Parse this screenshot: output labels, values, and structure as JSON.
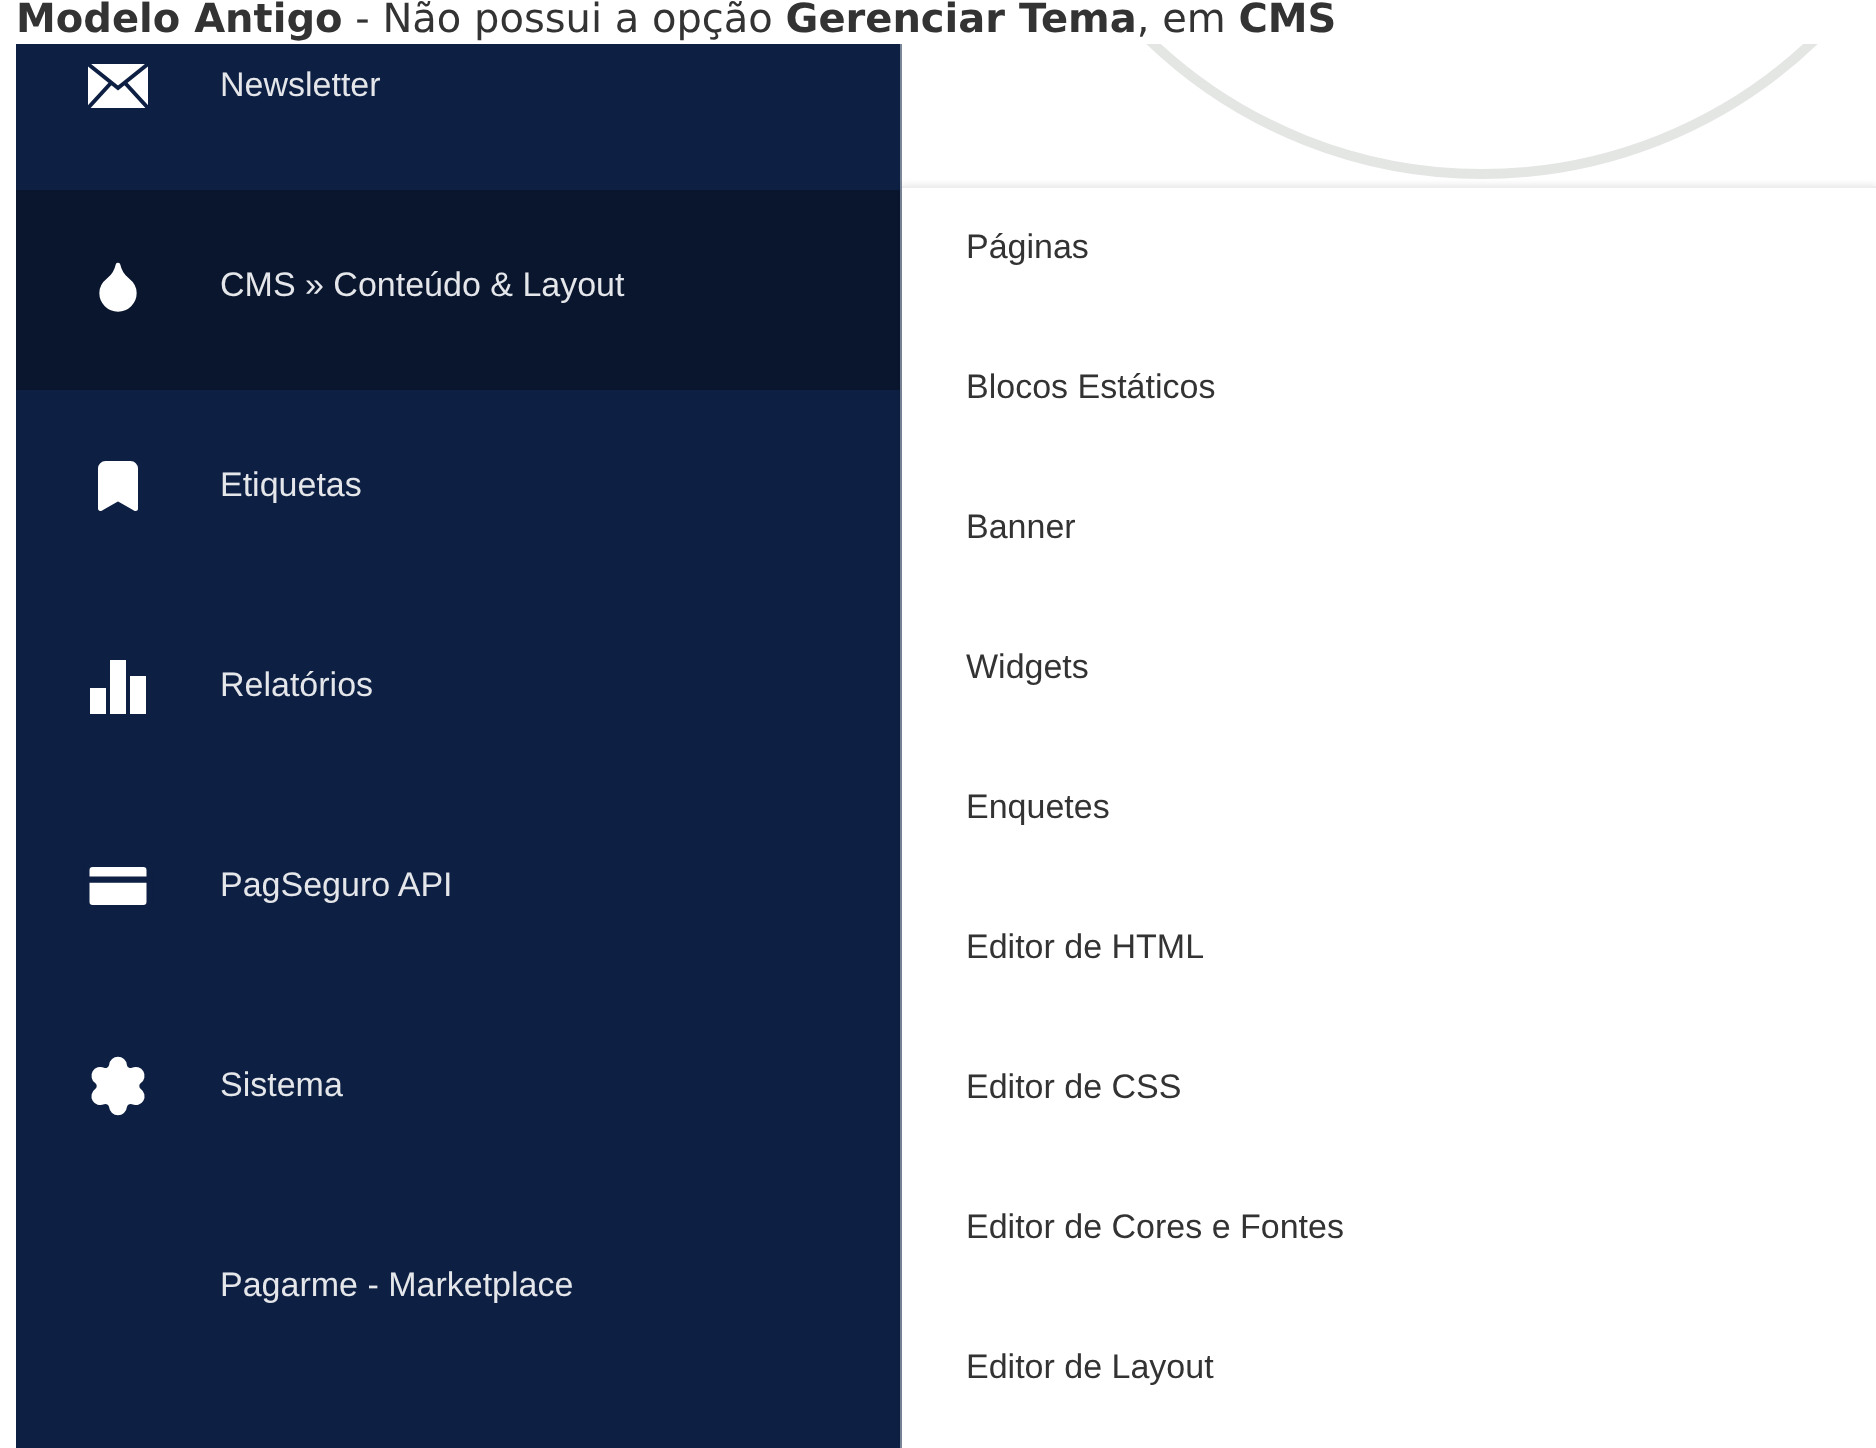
{
  "caption": "**Modelo Antigo** - Não possui a opção **Gerenciar Tema**, em **CMS**",
  "sidebar": {
    "items": [
      {
        "label": "Newsletter",
        "icon": true,
        "selected": false
      },
      {
        "label": "CMS » Conteúdo & Layout",
        "icon": true,
        "selected": true
      },
      {
        "label": "Etiquetas",
        "icon": true,
        "selected": false
      },
      {
        "label": "Relatórios",
        "icon": true,
        "selected": false
      },
      {
        "label": "PagSeguro API",
        "icon": true,
        "selected": false
      },
      {
        "label": "Sistema",
        "icon": true,
        "selected": false
      },
      {
        "label": "Pagarme - Marketplace",
        "icon": false,
        "selected": false
      }
    ]
  },
  "submenu": {
    "items": [
      "Páginas",
      "Blocos Estáticos",
      "Banner",
      "Widgets",
      "Enquetes",
      "Editor de HTML",
      "Editor de CSS",
      "Editor de Cores e Fontes",
      "Editor de Layout"
    ]
  }
}
